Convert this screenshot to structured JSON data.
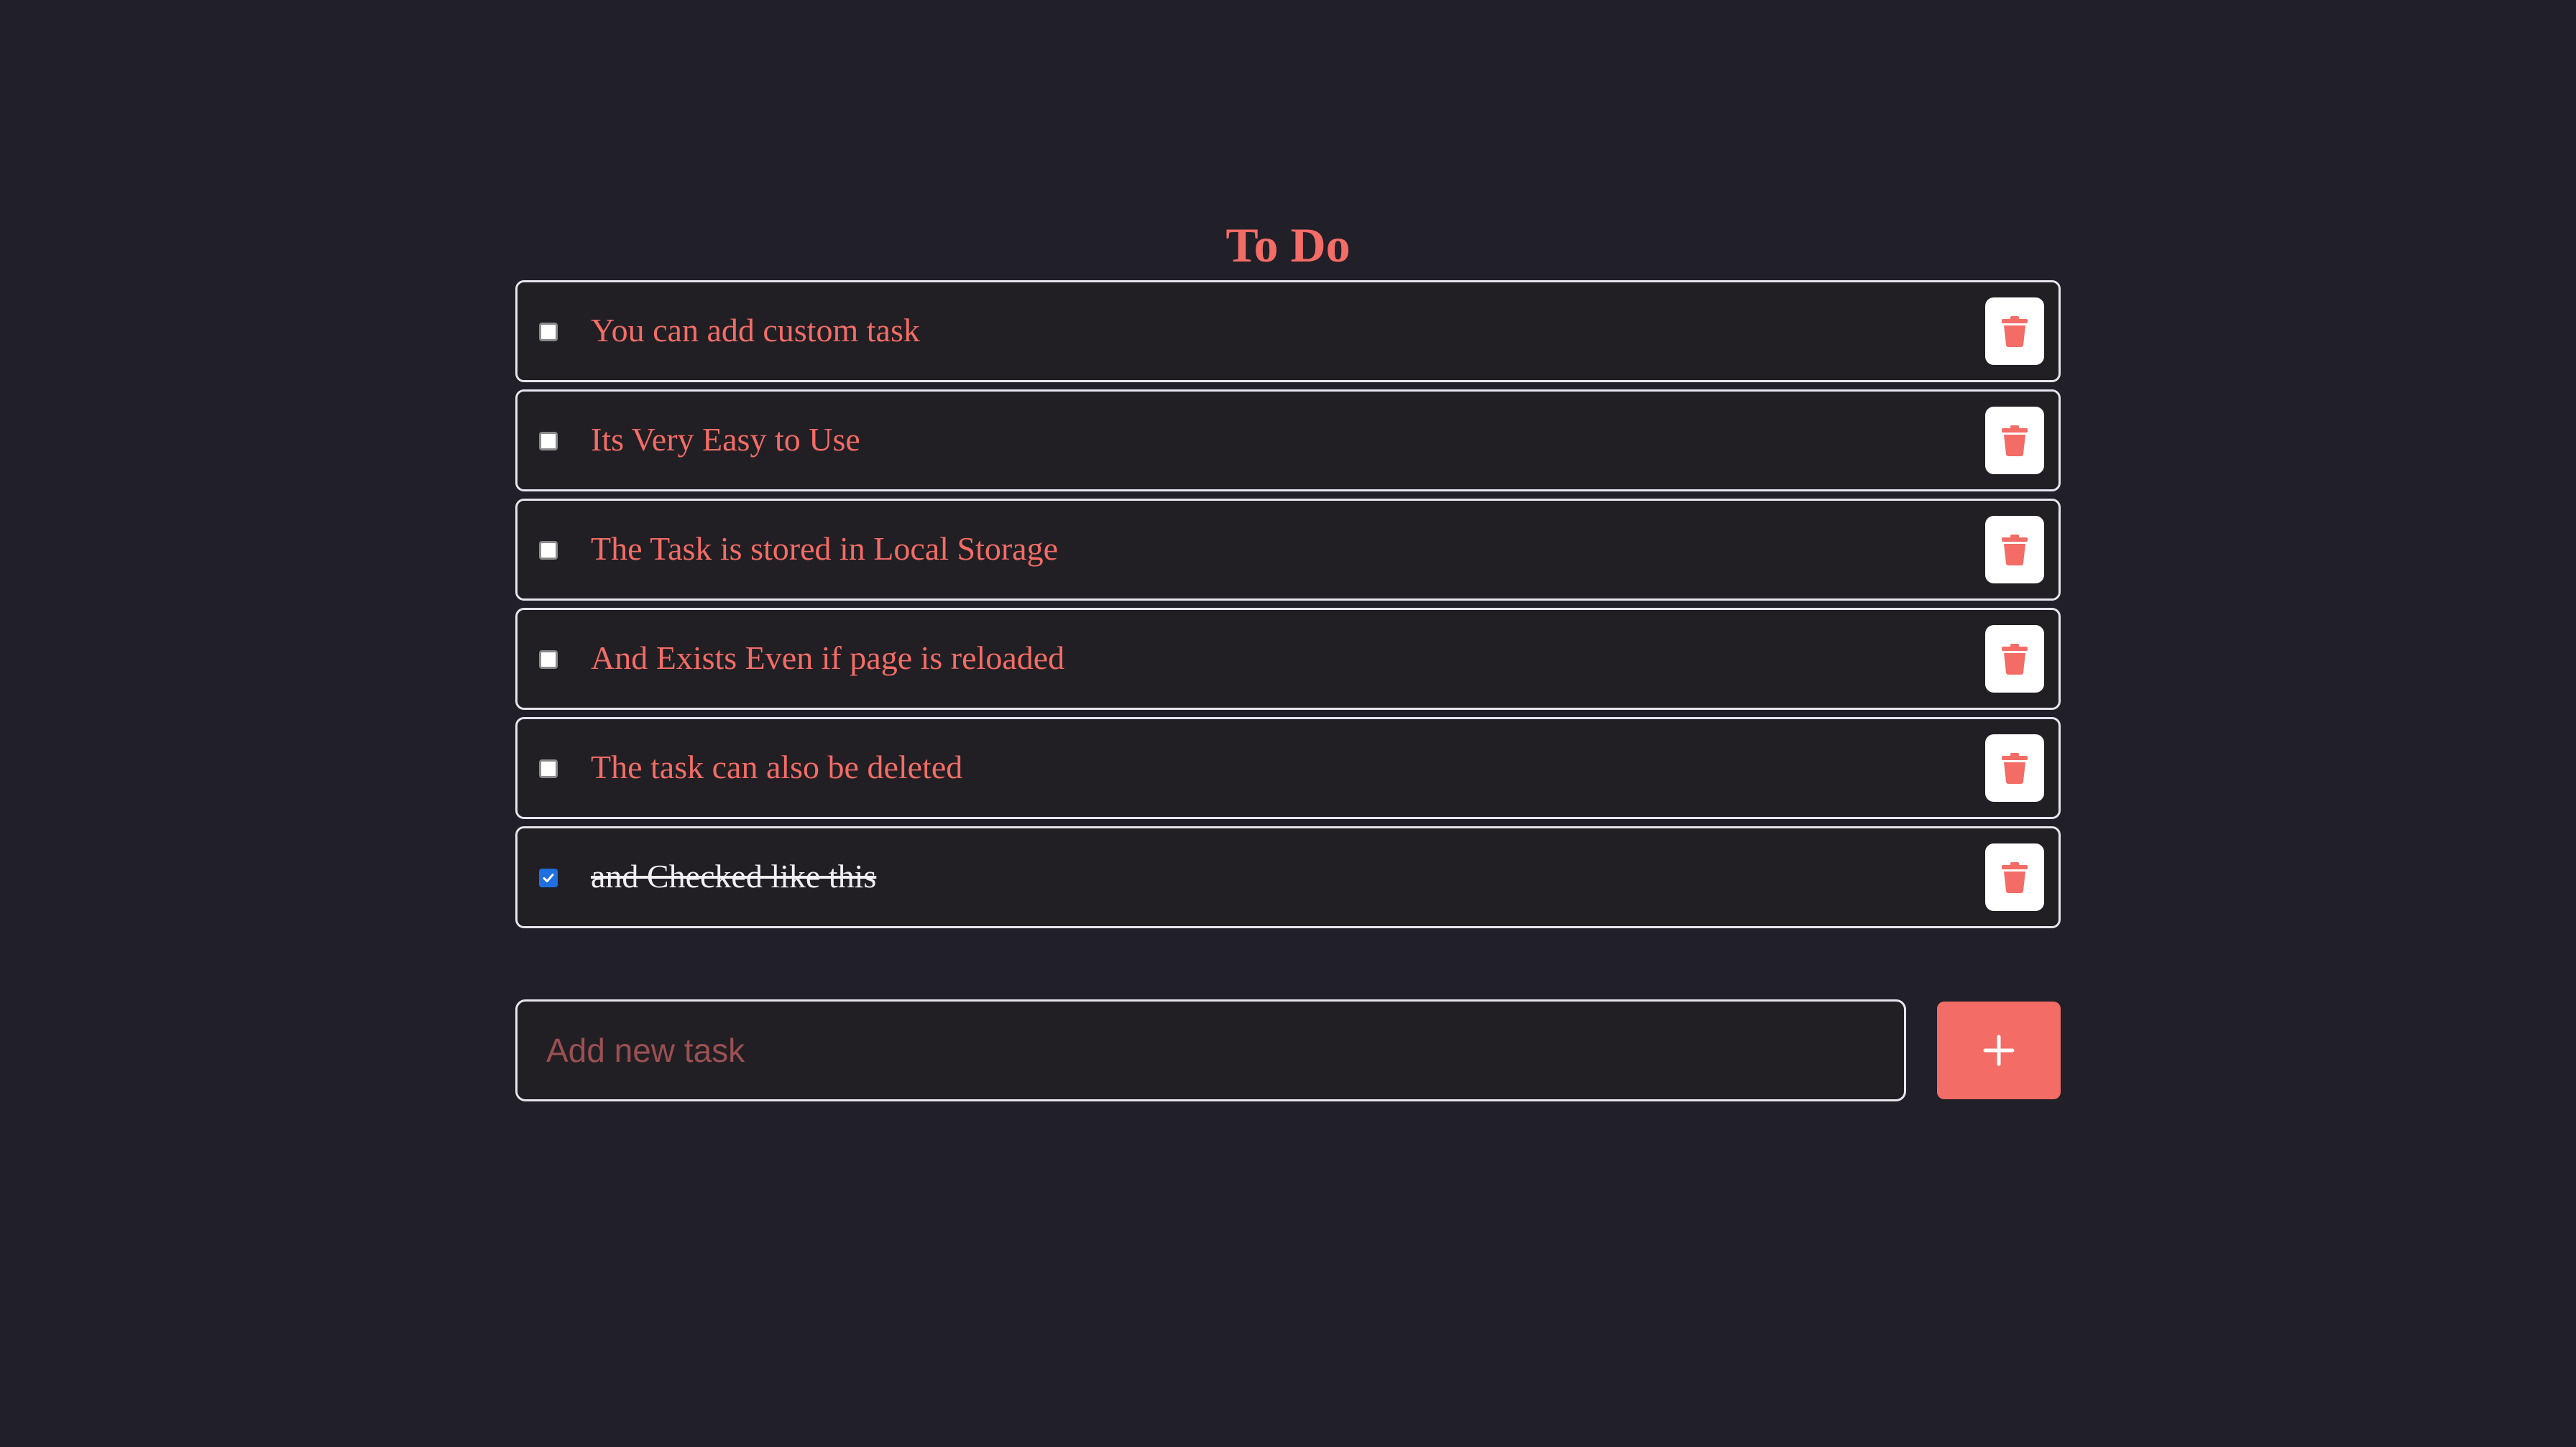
{
  "app": {
    "title": "To Do"
  },
  "tasks": [
    {
      "text": "You can add custom task",
      "checked": false
    },
    {
      "text": "Its Very Easy to Use",
      "checked": false
    },
    {
      "text": "The Task is stored in Local Storage",
      "checked": false
    },
    {
      "text": "And Exists Even if page is reloaded",
      "checked": false
    },
    {
      "text": "The task can also be deleted",
      "checked": false
    },
    {
      "text": "and Checked like this",
      "checked": true
    }
  ],
  "new_task": {
    "placeholder": "Add new task",
    "value": ""
  },
  "icons": {
    "delete": "trash-icon",
    "add": "plus-icon",
    "check": "check-icon"
  },
  "colors": {
    "background": "#211f28",
    "accent": "#f36c66",
    "border": "#e8e4ee",
    "checked": "#1f6fe0"
  }
}
